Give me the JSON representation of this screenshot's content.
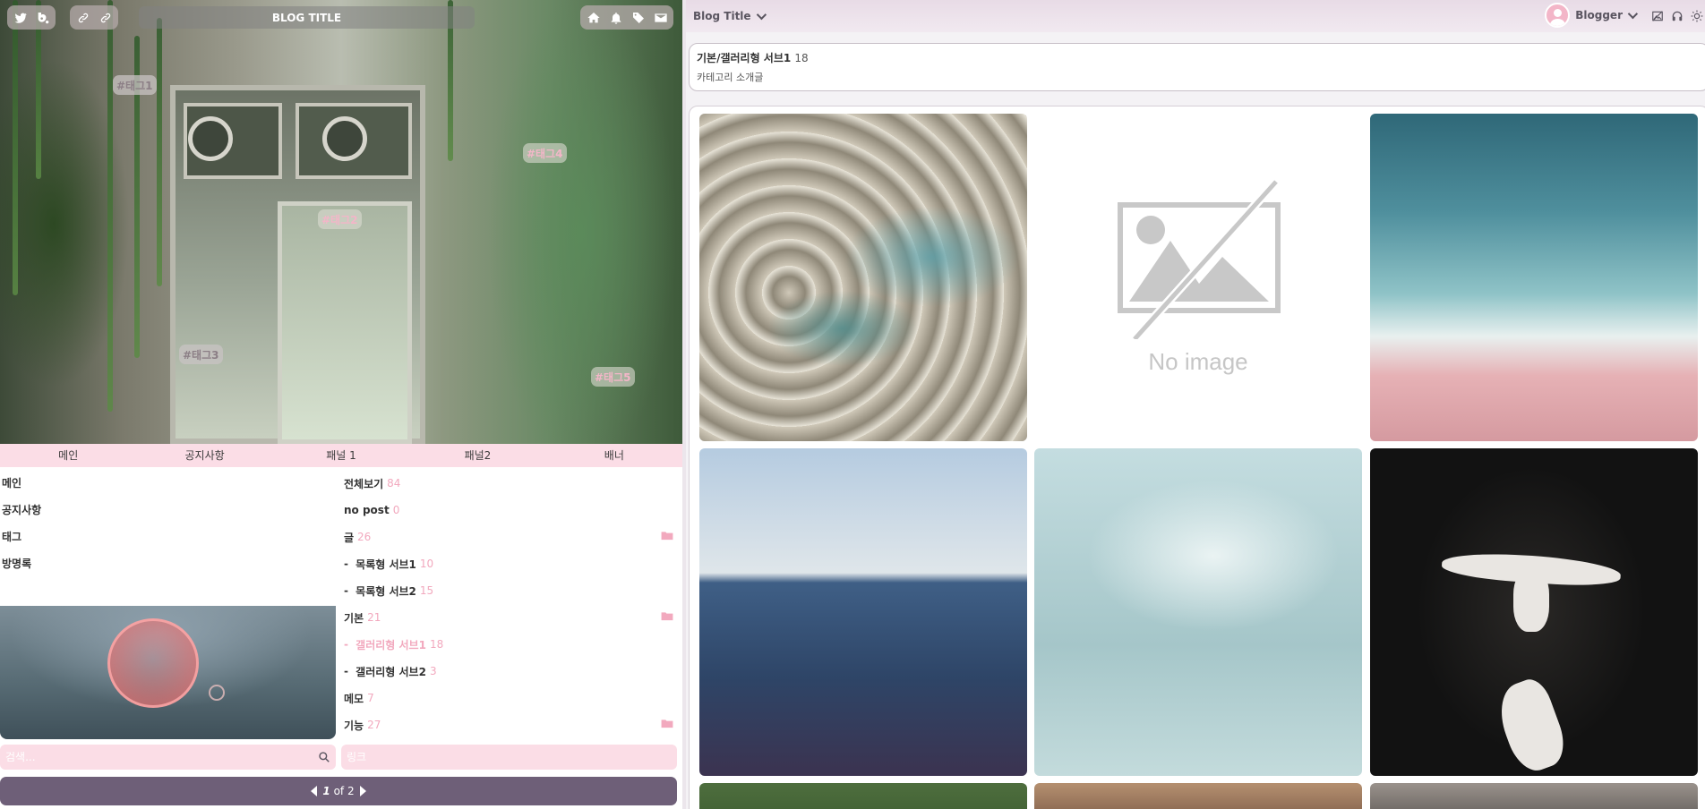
{
  "header": {
    "blog_title": "BLOG TITLE",
    "left_icons": [
      "twitter-icon",
      "blog-icon"
    ],
    "mid_icons": [
      "link-icon",
      "link-icon"
    ],
    "right_icons": [
      "home-icon",
      "bell-icon",
      "tag-icon",
      "mail-icon"
    ]
  },
  "hero": {
    "tags": [
      "#태그1",
      "#태그2",
      "#태그3",
      "#태그4",
      "#태그5"
    ]
  },
  "tabs": [
    "메인",
    "공지사항",
    "패널 1",
    "패널2",
    "배너"
  ],
  "nav": [
    "메인",
    "공지사항",
    "태그",
    "방명록"
  ],
  "categories": [
    {
      "name": "전체보기",
      "count": "84",
      "prefix": "",
      "folder": false,
      "active": false
    },
    {
      "name": "no post",
      "count": "0",
      "prefix": "",
      "folder": false,
      "active": false
    },
    {
      "name": "글",
      "count": "26",
      "prefix": "",
      "folder": true,
      "active": false
    },
    {
      "name": "목록형 서브1",
      "count": "10",
      "prefix": "- ",
      "folder": false,
      "active": false
    },
    {
      "name": "목록형 서브2",
      "count": "15",
      "prefix": "- ",
      "folder": false,
      "active": false
    },
    {
      "name": "기본",
      "count": "21",
      "prefix": "",
      "folder": true,
      "active": false
    },
    {
      "name": "갤러리형 서브1",
      "count": "18",
      "prefix": "- ",
      "folder": false,
      "active": true
    },
    {
      "name": "갤러리형 서브2",
      "count": "3",
      "prefix": "- ",
      "folder": false,
      "active": false
    },
    {
      "name": "메모",
      "count": "7",
      "prefix": "",
      "folder": false,
      "active": false
    },
    {
      "name": "기능",
      "count": "27",
      "prefix": "",
      "folder": true,
      "active": false
    }
  ],
  "search": {
    "placeholder": "검색..."
  },
  "link_label": "링크",
  "pager": {
    "current": "1",
    "of_label": "of",
    "total": "2"
  },
  "topbar": {
    "blog_title": "Blog Title",
    "user_name": "Blogger",
    "icons": [
      "no-image-icon",
      "headphones-icon",
      "sun-icon"
    ]
  },
  "category_info": {
    "name": "기본/갤러리형 서브1",
    "count": "18",
    "description": "카테고리 소개글"
  },
  "gallery": {
    "no_image_text": "No image"
  },
  "colors": {
    "accent_pink": "#fbdde6",
    "count_pink": "#f2a9be",
    "pager_purple": "#6e5f78"
  }
}
